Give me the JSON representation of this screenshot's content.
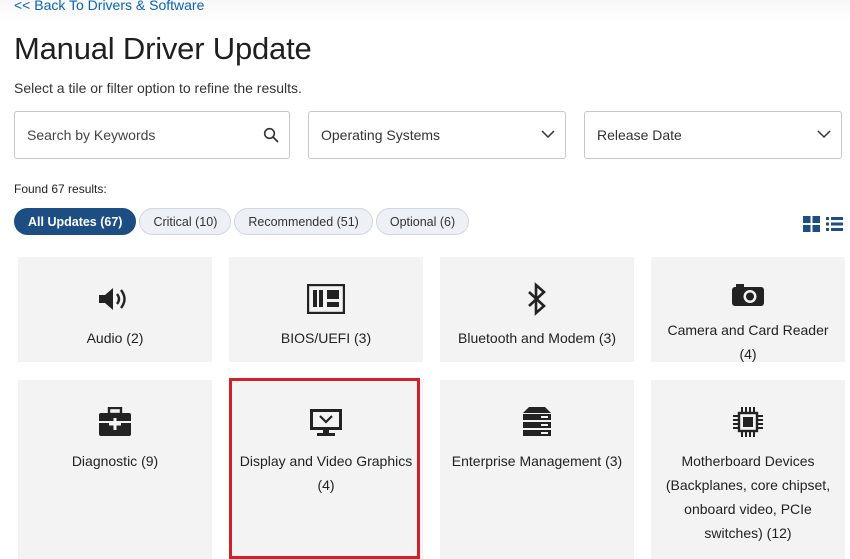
{
  "back_link": "<< Back To Drivers & Software",
  "title": "Manual Driver Update",
  "subtitle": "Select a tile or filter option to refine the results.",
  "search": {
    "placeholder": "Search by Keywords",
    "icon": "search-icon"
  },
  "filters": {
    "operating_systems": "Operating Systems",
    "release_date": "Release Date"
  },
  "results_text": "Found 67 results:",
  "chips": [
    {
      "label": "All Updates (67)",
      "active": true
    },
    {
      "label": "Critical (10)",
      "active": false
    },
    {
      "label": "Recommended (51)",
      "active": false
    },
    {
      "label": "Optional (6)",
      "active": false
    }
  ],
  "view_toggle": {
    "grid_icon": "grid-view-icon",
    "list_icon": "list-view-icon",
    "selected": "grid"
  },
  "tiles": [
    {
      "label": "Audio (2)",
      "icon": "speaker-icon"
    },
    {
      "label": "BIOS/UEFI (3)",
      "icon": "bios-chip-icon"
    },
    {
      "label": "Bluetooth and Modem (3)",
      "icon": "bluetooth-icon"
    },
    {
      "label": "Camera and Card Reader (4)",
      "icon": "camera-icon"
    },
    {
      "label": "Diagnostic (9)",
      "icon": "toolbox-icon"
    },
    {
      "label": "Display and Video Graphics (4)",
      "icon": "monitor-icon"
    },
    {
      "label": "Enterprise Management (3)",
      "icon": "server-rack-icon"
    },
    {
      "label": "Motherboard Devices (Backplanes, core chipset, onboard video, PCIe switches) (12)",
      "icon": "motherboard-chip-icon"
    }
  ],
  "colors": {
    "accent": "#1c4e84",
    "link": "#0b63b5",
    "highlight": "#d0202a"
  }
}
